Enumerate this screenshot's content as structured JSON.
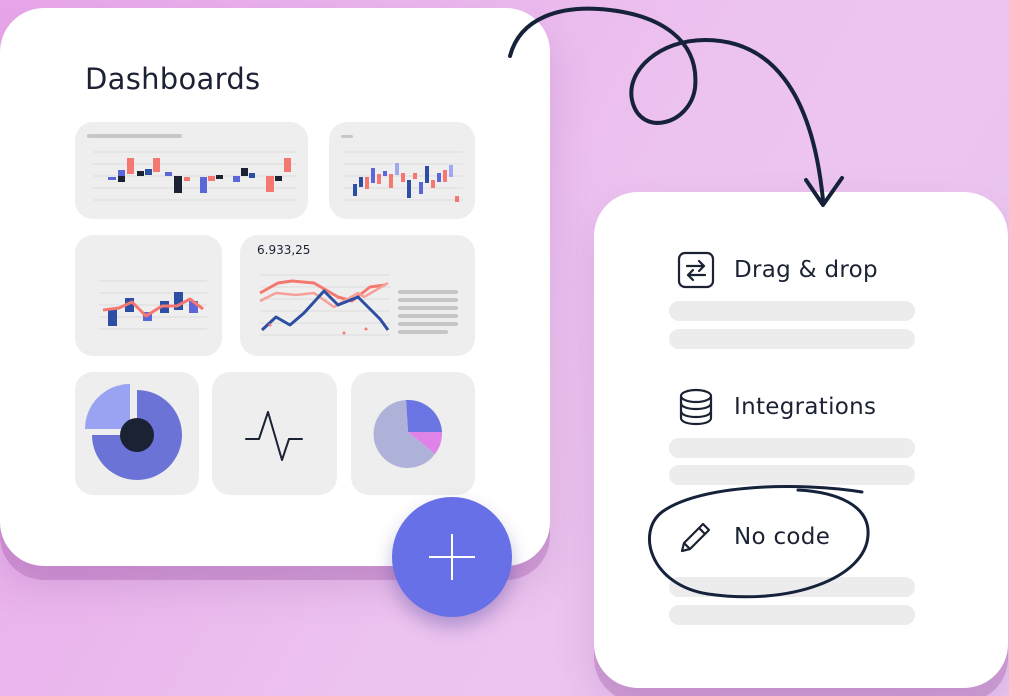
{
  "dashboards": {
    "title": "Dashboards",
    "kpi_value": "6.933,25",
    "add_button_symbol": "+"
  },
  "features": {
    "items": [
      {
        "label": "Drag & drop",
        "icon": "swap-arrows-icon"
      },
      {
        "label": "Integrations",
        "icon": "database-icon"
      },
      {
        "label": "No code",
        "icon": "pencil-icon"
      }
    ]
  },
  "colors": {
    "accent": "#6770e6",
    "ink": "#1b2233",
    "coral": "#f4786f",
    "navy": "#2c4fa3",
    "lavender": "#8a8fe8",
    "pink": "#e083e8"
  }
}
